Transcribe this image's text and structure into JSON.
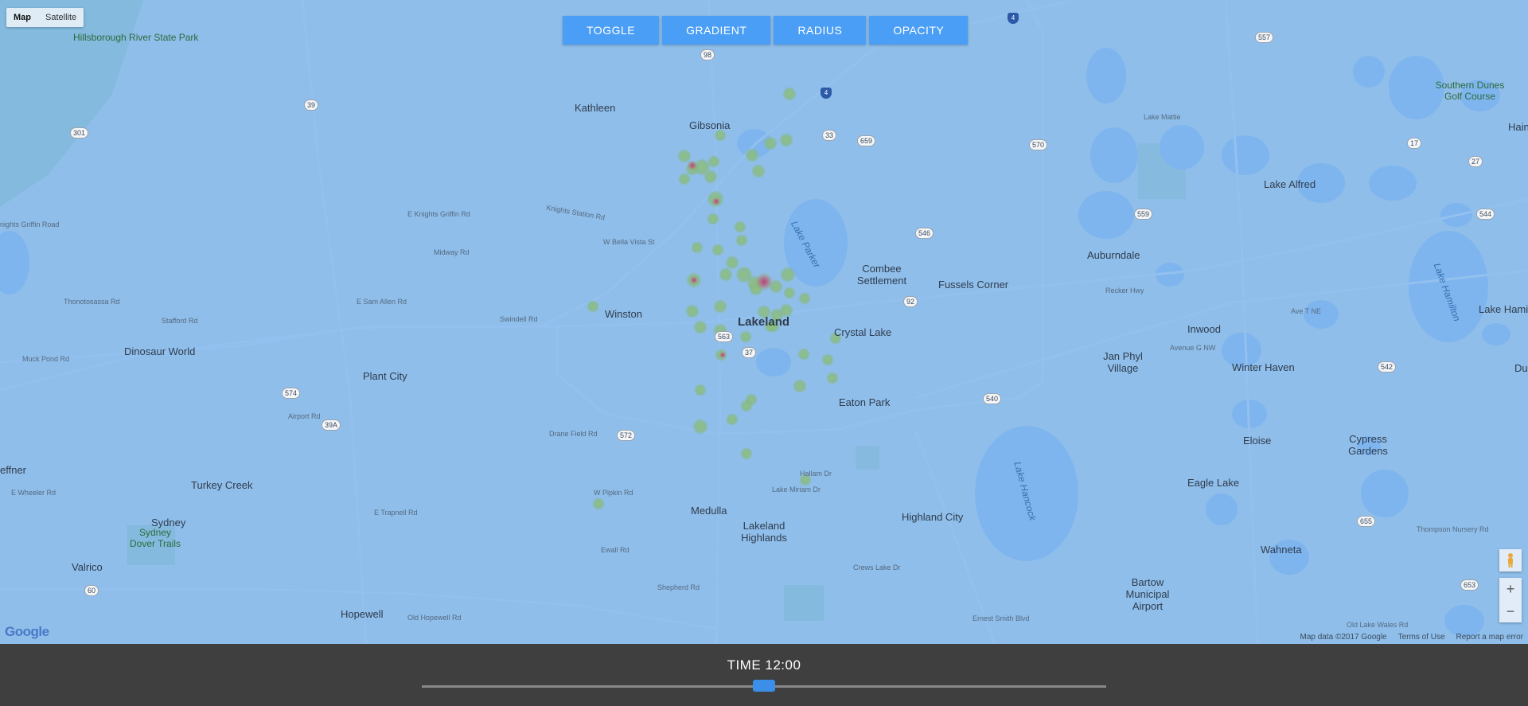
{
  "map": {
    "type_control": {
      "map": "Map",
      "satellite": "Satellite",
      "active": "Map"
    },
    "attribution": {
      "data": "Map data ©2017 Google",
      "terms": "Terms of Use",
      "report": "Report a map error"
    },
    "logo": "Google",
    "zoom_in": "+",
    "zoom_out": "−",
    "places": {
      "hillsborough": "Hillsborough River State Park",
      "kathleen": "Kathleen",
      "gibsonia": "Gibsonia",
      "lakeland": "Lakeland",
      "winston": "Winston",
      "combee": "Combee Settlement",
      "fussels": "Fussels Corner",
      "crystal": "Crystal Lake",
      "dinosaur": "Dinosaur World",
      "plantcity": "Plant City",
      "eaton": "Eaton Park",
      "turkeycreek": "Turkey Creek",
      "medulla": "Medulla",
      "lakelandhighlands": "Lakeland Highlands",
      "highlandcity": "Highland City",
      "sydney": "Sydney",
      "valrico": "Valrico",
      "sydneydover": "Sydney Dover Trails",
      "hopewell": "Hopewell",
      "auburndale": "Auburndale",
      "lakealfred": "Lake Alfred",
      "inwood": "Inwood",
      "jan": "Jan Phyl Village",
      "winterhaven": "Winter Haven",
      "eloise": "Eloise",
      "eaglelake": "Eagle Lake",
      "cypress": "Cypress Gardens",
      "wahneta": "Wahneta",
      "bartow": "Bartow Municipal Airport",
      "southern": "Southern Dunes Golf Course",
      "lakehamilton": "Lake Hamilton",
      "lakeparker": "Lake Parker",
      "lakehancock": "Lake Hancock",
      "lakehamiltonw": "Lake Hamilton",
      "lakemattie": "Lake Mattie",
      "effner": "effner",
      "haines": "Hain",
      "dun": "Dun"
    },
    "roads": {
      "knights_griffin": "E Knights Griffin Rd",
      "knights_station": "Knights Station Rd",
      "wbella": "W Bella Vista St",
      "midway": "Midway Rd",
      "stafford": "Stafford Rd",
      "thonotosassa": "Thonotosassa Rd",
      "esamallen": "E Sam Allen Rd",
      "swindell": "Swindell Rd",
      "muckpond": "Muck Pond Rd",
      "airport": "Airport Rd",
      "drane": "Drane Field Rd",
      "wpipkin": "W Pipkin Rd",
      "etrapnell": "E Trapnell Rd",
      "ewheeler": "E Wheeler Rd",
      "ewall": "Ewall Rd",
      "shepherd": "Shepherd Rd",
      "oldhopewell": "Old Hopewell Rd",
      "crewslake": "Crews Lake Dr",
      "ernestsmith": "Ernest Smith Blvd",
      "thompsonnursery": "Thompson Nursery Rd",
      "oldlakewales": "Old Lake Wales Rd",
      "avenue": "Avenue G NW",
      "avet": "Ave T NE",
      "recker": "Recker Hwy",
      "hallam": "Hallam Dr",
      "lakeminam": "Lake Miriam Dr",
      "knightsgriffin_w": "nights Griffin Road"
    },
    "shields": [
      "98",
      "4",
      "4",
      "33",
      "659",
      "570",
      "559",
      "557",
      "92",
      "17",
      "544",
      "546",
      "542",
      "563",
      "37",
      "540",
      "60",
      "39",
      "39A",
      "574",
      "572",
      "655",
      "653",
      "27",
      "301"
    ]
  },
  "toolbar": {
    "toggle": "TOGGLE",
    "gradient": "GRADIENT",
    "radius": "RADIUS",
    "opacity": "OPACITY"
  },
  "time_panel": {
    "label": "TIME 12:00",
    "slider_fraction": 0.5
  },
  "colors": {
    "tint": "#78b2f0",
    "button": "#4a9ef5",
    "panel": "#3f3f3f",
    "thumb": "#3b8fe8",
    "heat_low": "#6cc06a",
    "heat_high": "#c03a6a"
  }
}
